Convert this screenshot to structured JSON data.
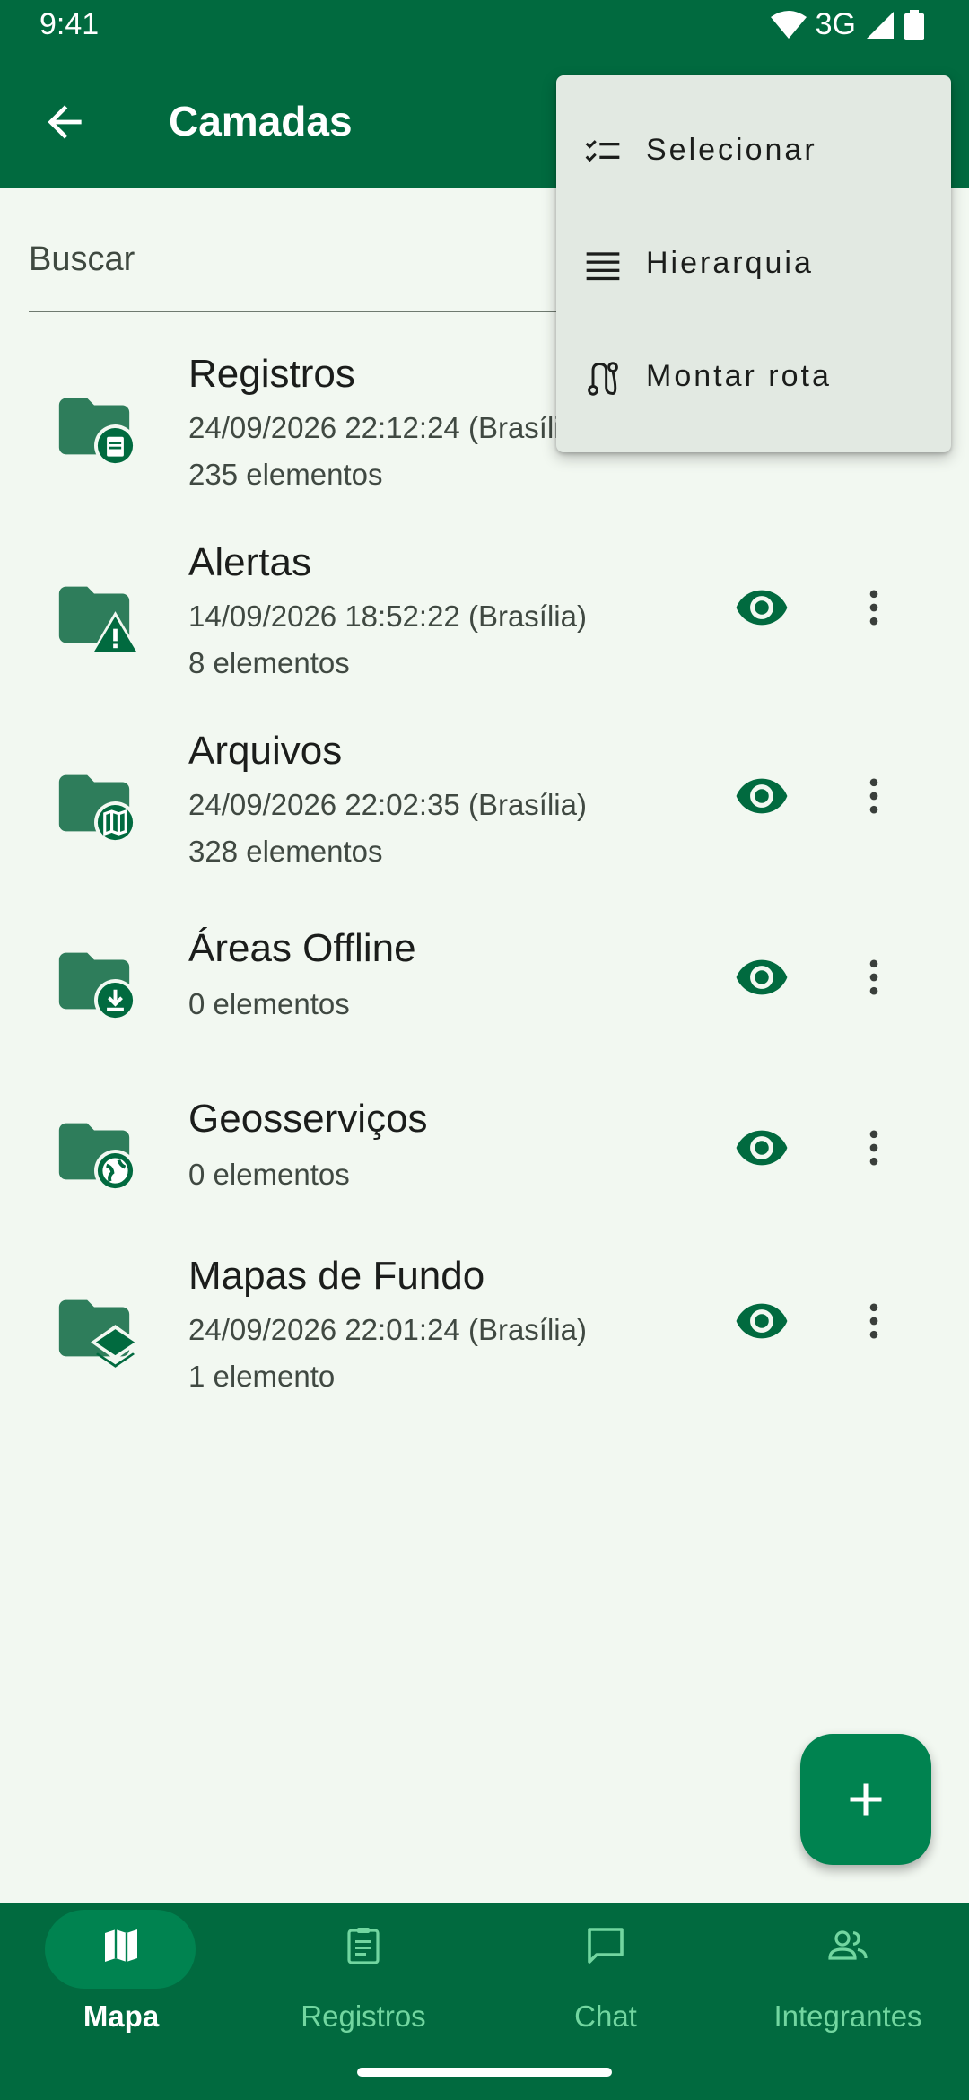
{
  "status": {
    "time": "9:41",
    "network": "3G"
  },
  "appbar": {
    "title": "Camadas"
  },
  "search": {
    "placeholder": "Buscar"
  },
  "layers": [
    {
      "title": "Registros",
      "date": "24/09/2026 22:12:24 (Brasília)",
      "count": "235 elementos",
      "icon": "folder-clipboard-icon"
    },
    {
      "title": "Alertas",
      "date": "14/09/2026 18:52:22 (Brasília)",
      "count": "8 elementos",
      "icon": "folder-alert-icon"
    },
    {
      "title": "Arquivos",
      "date": "24/09/2026 22:02:35 (Brasília)",
      "count": "328 elementos",
      "icon": "folder-map-icon"
    },
    {
      "title": "Áreas Offline",
      "date": "",
      "count": "0 elementos",
      "icon": "folder-download-icon"
    },
    {
      "title": "Geosserviços",
      "date": "",
      "count": "0 elementos",
      "icon": "folder-globe-icon"
    },
    {
      "title": "Mapas de Fundo",
      "date": "24/09/2026 22:01:24 (Brasília)",
      "count": "1 elemento",
      "icon": "folder-layers-icon"
    }
  ],
  "menu": {
    "items": [
      {
        "label": "Selecionar",
        "icon": "checklist-icon"
      },
      {
        "label": "Hierarquia",
        "icon": "lines-icon"
      },
      {
        "label": "Montar rota",
        "icon": "route-icon"
      }
    ]
  },
  "bottom_nav": {
    "items": [
      {
        "label": "Mapa",
        "icon": "map-icon",
        "active": true
      },
      {
        "label": "Registros",
        "icon": "clipboard-icon",
        "active": false
      },
      {
        "label": "Chat",
        "icon": "chat-icon",
        "active": false
      },
      {
        "label": "Integrantes",
        "icon": "people-icon",
        "active": false
      }
    ]
  },
  "colors": {
    "primary": "#016A3F",
    "accent": "#008350",
    "background": "#F2F8F1",
    "folder": "#2E7D5B",
    "nav_inactive": "#72D6A0"
  }
}
